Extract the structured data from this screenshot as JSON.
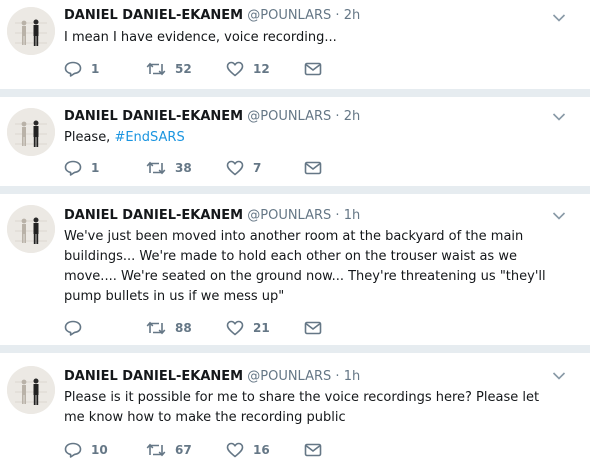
{
  "tweets": [
    {
      "name": "DANIEL DANIEL-EKANEM",
      "handle": "@POUNLARS",
      "separator": "·",
      "time": "2h",
      "text_before": "I mean I have evidence, voice recording...",
      "hashtag": "",
      "replies": "1",
      "retweets": "52",
      "likes": "12"
    },
    {
      "name": "DANIEL DANIEL-EKANEM",
      "handle": "@POUNLARS",
      "separator": "·",
      "time": "2h",
      "text_before": "Please, ",
      "hashtag": "#EndSARS",
      "replies": "1",
      "retweets": "38",
      "likes": "7"
    },
    {
      "name": "DANIEL DANIEL-EKANEM",
      "handle": "@POUNLARS",
      "separator": "·",
      "time": "1h",
      "text_before": "We've just been moved into another room at the backyard of the main buildings... We're made to hold each other on the trouser waist as we move.... We're seated on the ground now... They're threatening us \"they'll pump bullets in us if we mess up\"",
      "hashtag": "",
      "replies": "",
      "retweets": "88",
      "likes": "21"
    },
    {
      "name": "DANIEL DANIEL-EKANEM",
      "handle": "@POUNLARS",
      "separator": "·",
      "time": "1h",
      "text_before": "Please is it possible for me to share the voice recordings here?  Please let me know how to make the recording public",
      "hashtag": "",
      "replies": "10",
      "retweets": "67",
      "likes": "16"
    }
  ],
  "icons": {
    "reply": "reply-icon",
    "retweet": "retweet-icon",
    "like": "heart-icon",
    "message": "envelope-icon",
    "menu": "chevron-down-icon"
  },
  "colors": {
    "name": "#14171a",
    "meta": "#657786",
    "link": "#1b95e0",
    "separator_background": "#e6ecf0"
  }
}
